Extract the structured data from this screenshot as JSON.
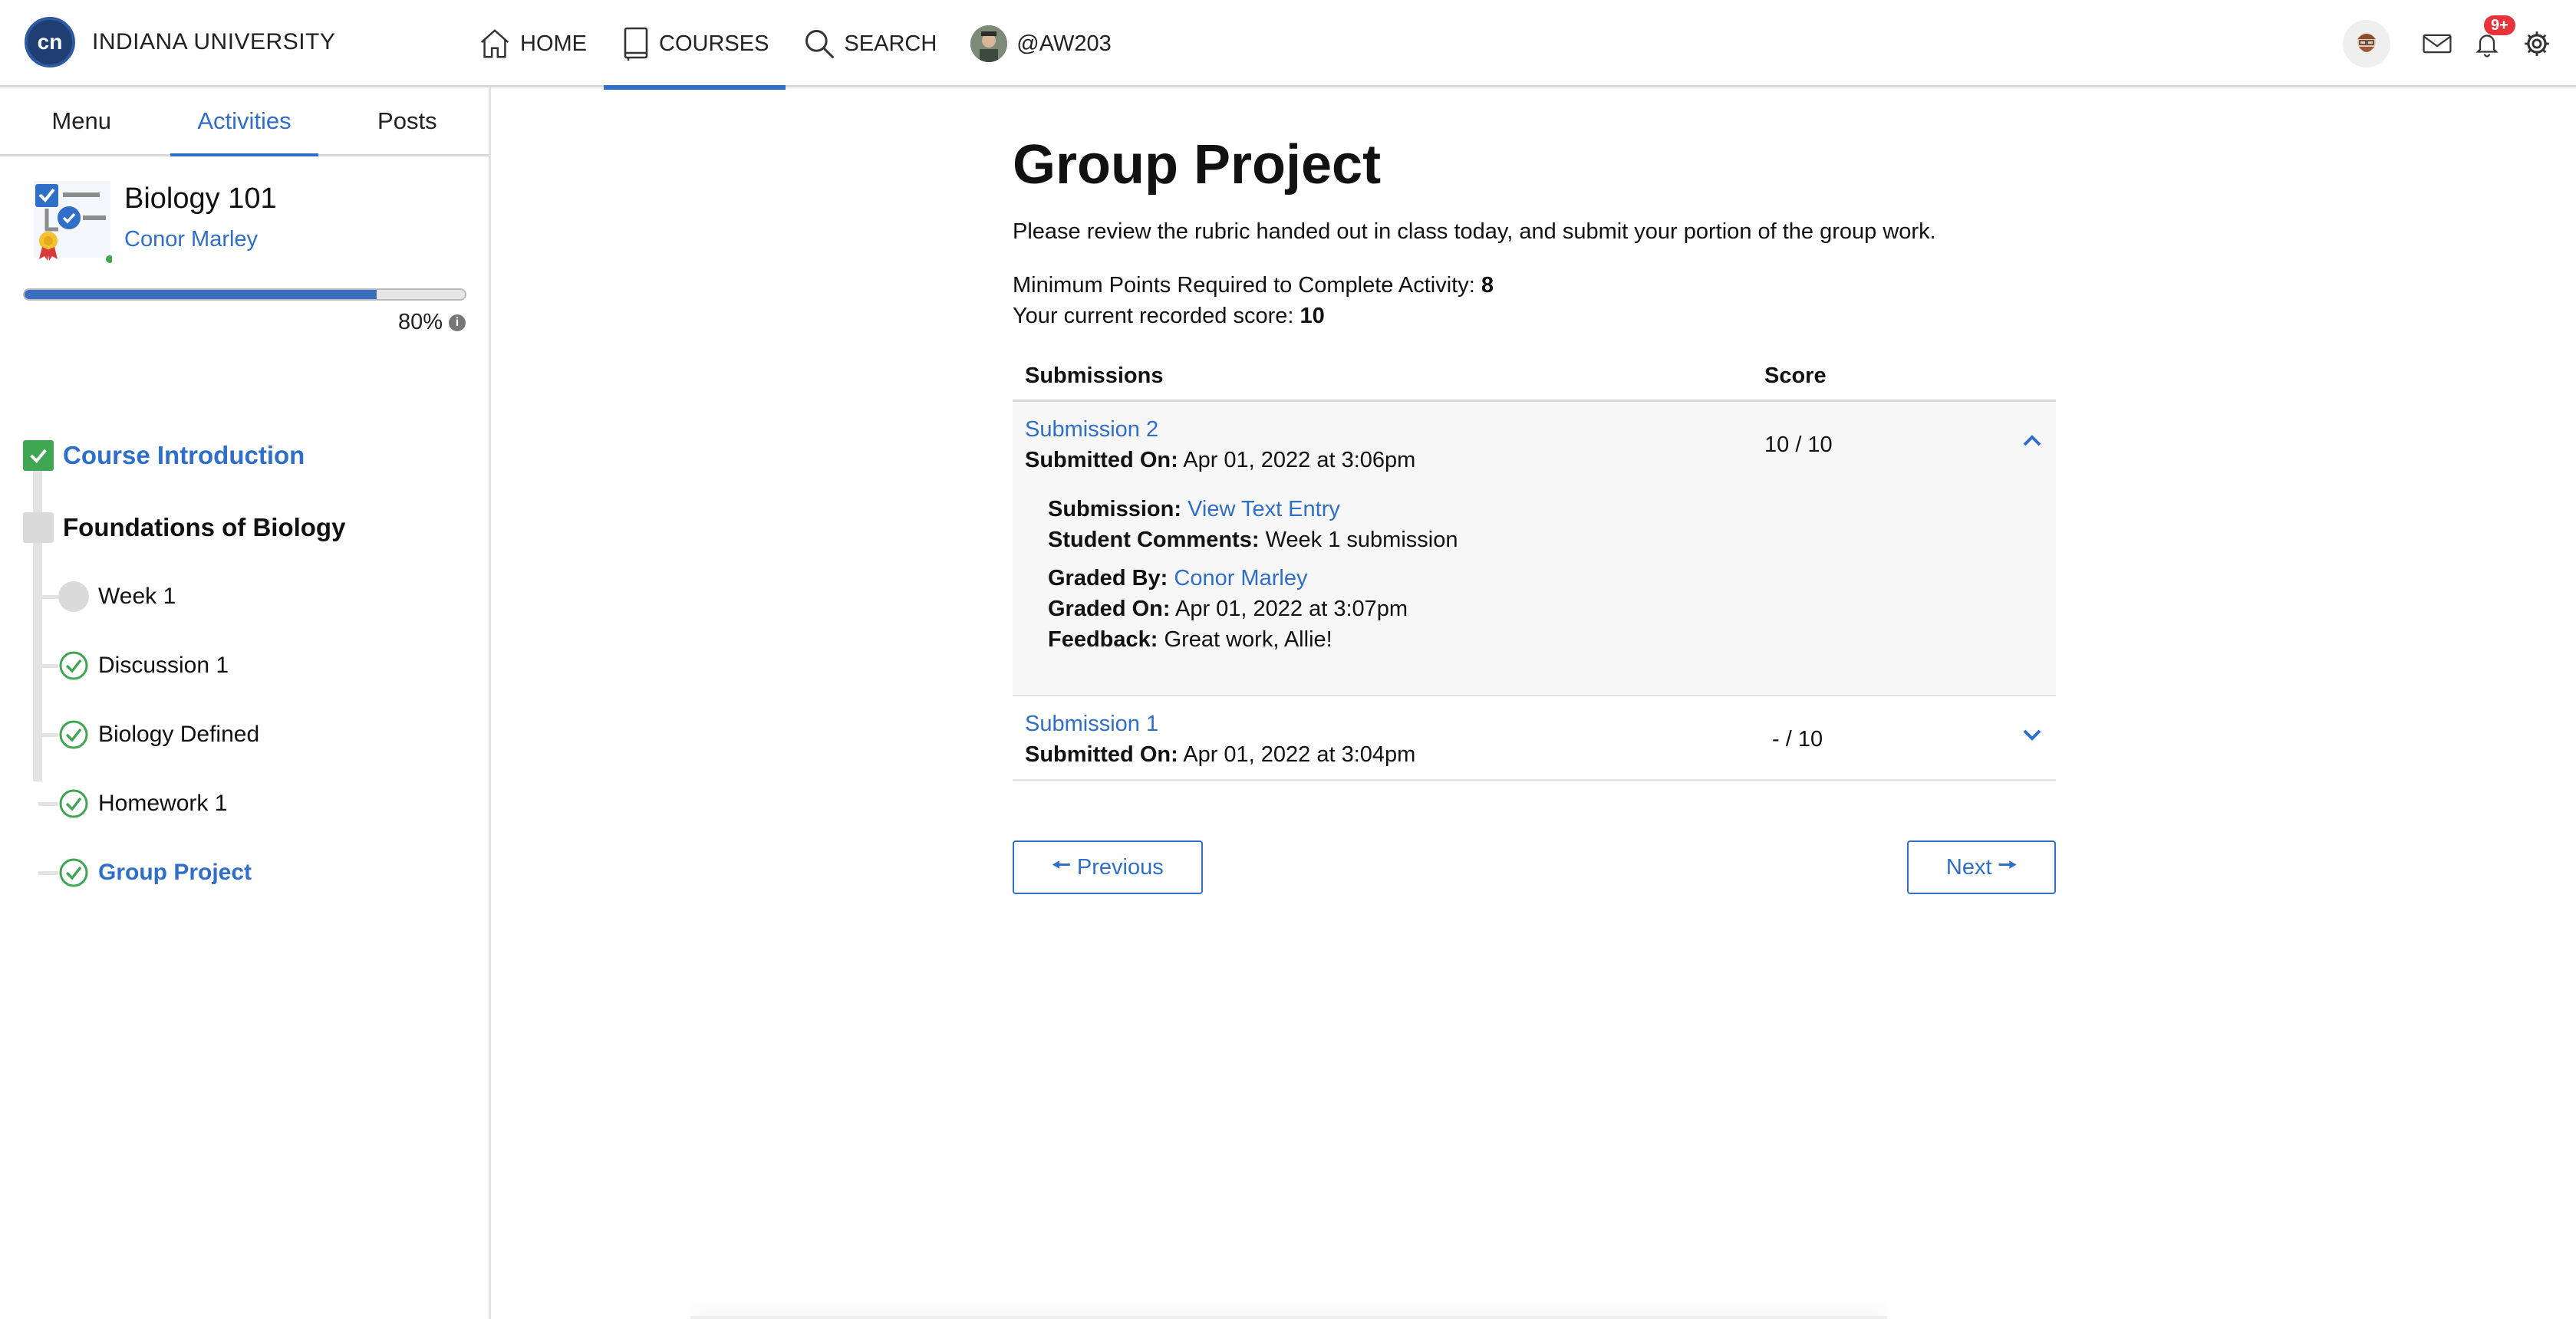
{
  "header": {
    "brand_name": "INDIANA UNIVERSITY",
    "nav": [
      {
        "label": "HOME",
        "icon": "home-icon"
      },
      {
        "label": "COURSES",
        "icon": "book-icon",
        "active": true
      },
      {
        "label": "SEARCH",
        "icon": "search-icon"
      },
      {
        "label": "@AW203",
        "icon": "user-avatar"
      }
    ],
    "notifications_badge": "9+"
  },
  "sidebar": {
    "tabs": [
      "Menu",
      "Activities",
      "Posts"
    ],
    "active_tab": "Activities",
    "course_title": "Biology 101",
    "course_teacher": "Conor Marley",
    "progress_percent": 80,
    "progress_label": "80%",
    "sections": [
      {
        "label": "Course Introduction",
        "status": "complete"
      },
      {
        "label": "Foundations of Biology",
        "status": "in-progress"
      }
    ],
    "items": [
      {
        "label": "Week 1",
        "status": "incomplete"
      },
      {
        "label": "Discussion 1",
        "status": "complete"
      },
      {
        "label": "Biology Defined",
        "status": "complete"
      },
      {
        "label": "Homework 1",
        "status": "complete"
      },
      {
        "label": "Group Project",
        "status": "complete",
        "active": true
      }
    ]
  },
  "main": {
    "title": "Group Project",
    "description": "Please review the rubric handed out in class today, and submit your portion of the group work.",
    "min_points_label": "Minimum Points Required to Complete Activity:",
    "min_points_value": "8",
    "current_score_label": "Your current recorded score:",
    "current_score_value": "10",
    "table": {
      "col_submissions": "Submissions",
      "col_score": "Score",
      "rows": [
        {
          "title": "Submission 2",
          "submitted_label": "Submitted On:",
          "submitted_value": "Apr 01, 2022 at 3:06pm",
          "score": "10 / 10",
          "expanded": true,
          "submission_label": "Submission:",
          "submission_value": "View Text Entry",
          "comments_label": "Student Comments:",
          "comments_value": "Week 1 submission",
          "graded_by_label": "Graded By:",
          "graded_by_value": "Conor Marley",
          "graded_on_label": "Graded On:",
          "graded_on_value": "Apr 01, 2022 at 3:07pm",
          "feedback_label": "Feedback:",
          "feedback_value": "Great work, Allie!"
        },
        {
          "title": "Submission 1",
          "submitted_label": "Submitted On:",
          "submitted_value": "Apr 01, 2022 at 3:04pm",
          "score": "- / 10",
          "expanded": false
        }
      ]
    },
    "prev_label": "Previous",
    "next_label": "Next"
  },
  "colors": {
    "accent": "#2f6fca",
    "success": "#3fa652",
    "badge": "#e8333c",
    "progress": "#3a6fc0"
  }
}
